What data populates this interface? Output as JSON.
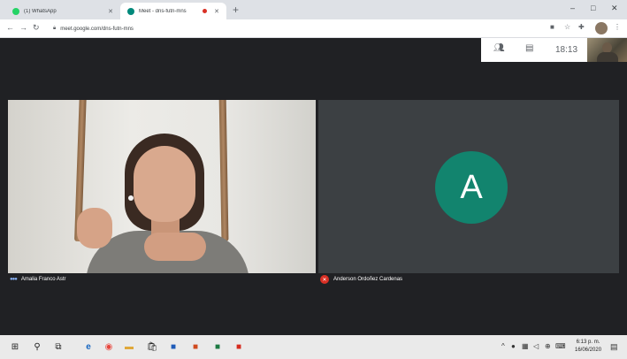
{
  "browser": {
    "tabs": [
      {
        "title": "(1) WhatsApp",
        "active": false
      },
      {
        "title": "Meet - dns-futn-mns",
        "active": true,
        "recording": true
      }
    ],
    "new_tab": "+",
    "window_controls": {
      "minimize": "–",
      "maximize": "□",
      "close": "✕"
    },
    "url": "meet.google.com/dns-futn-mns"
  },
  "meet": {
    "time": "18:13",
    "participants": [
      {
        "name": "Amalia Franco Astr",
        "has_video": true
      },
      {
        "name": "Anderson Ordoñez Cardenas",
        "initial": "A",
        "avatar_color": "#12846e",
        "muted": true
      }
    ]
  },
  "taskbar": {
    "apps": [
      "windows-start",
      "search",
      "task-view",
      "edge",
      "chrome",
      "file-explorer",
      "store",
      "word",
      "powerpoint",
      "excel",
      "acrobat"
    ],
    "clock_time": "6:13 p. m.",
    "clock_date": "16/06/2020"
  },
  "colors": {
    "meet_bg": "#202124",
    "avatar": "#12846e",
    "muted": "#d93025"
  }
}
